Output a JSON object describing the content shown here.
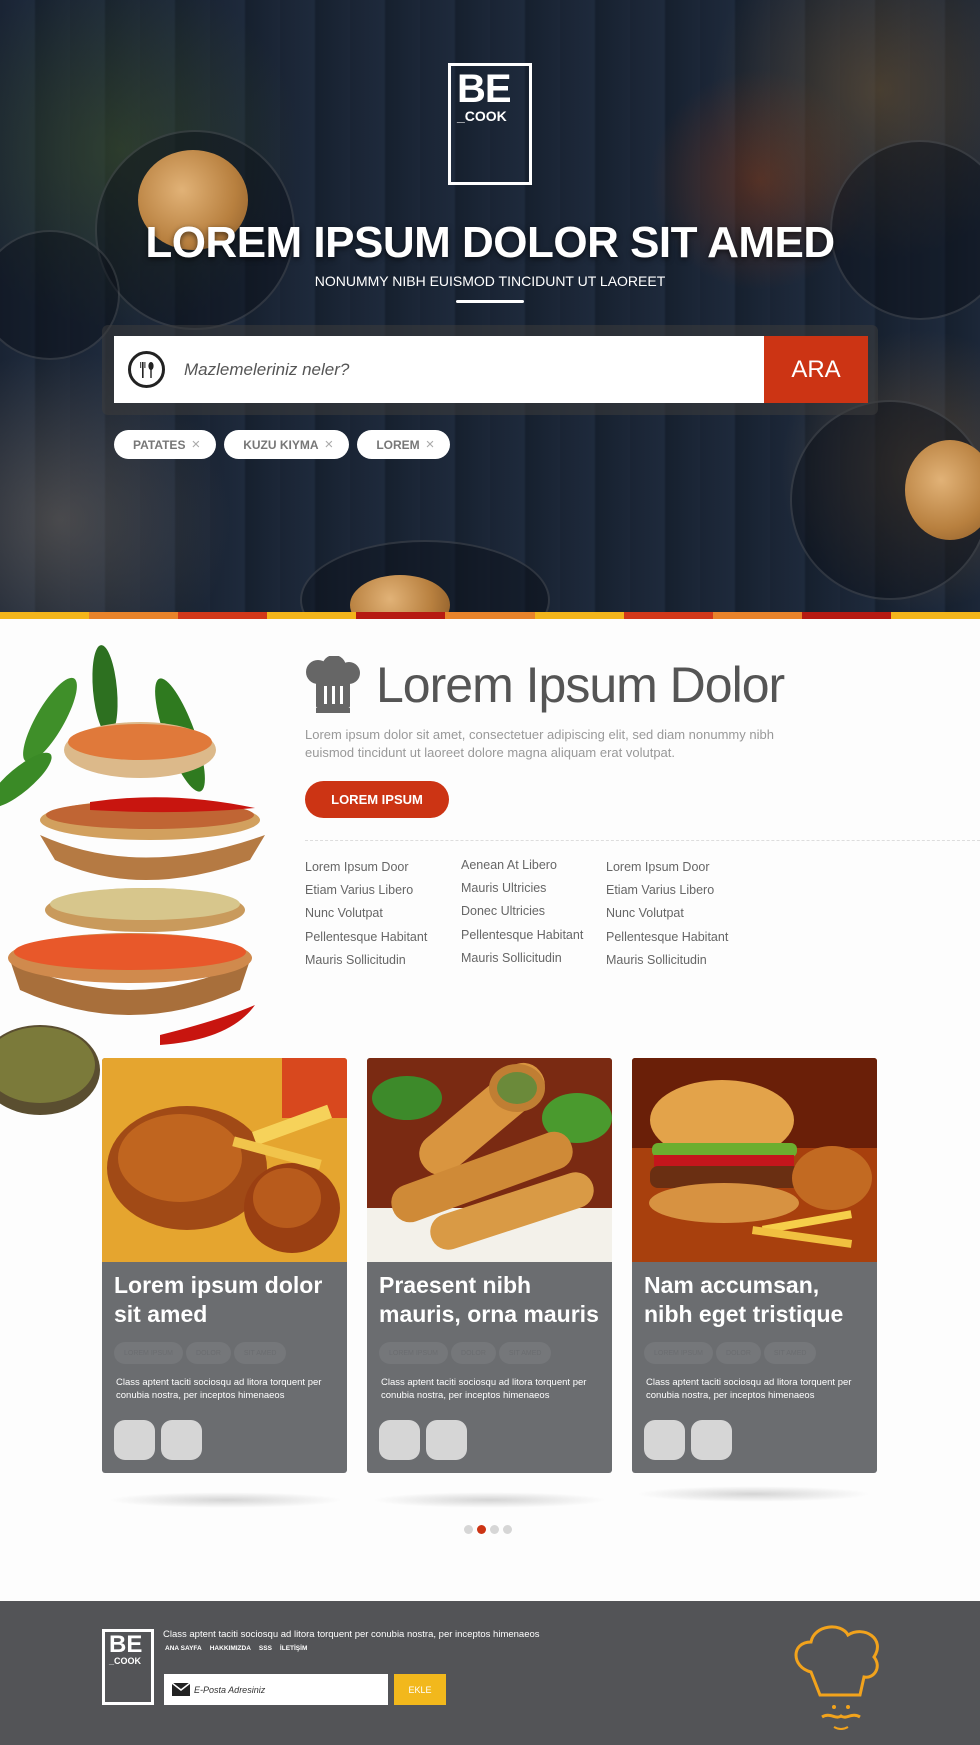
{
  "hero": {
    "logo_be": "BE",
    "logo_cook": "_COOK",
    "title": "LOREM IPSUM DOLOR SIT AMED",
    "subtitle": "NONUMMY NIBH EUISMOD TINCIDUNT UT LAOREET",
    "search_placeholder": "Mazlemeleriniz neler?",
    "search_button": "ARA",
    "tags": [
      "PATATES",
      "KUZU KIYMA",
      "LOREM"
    ],
    "tag_remove": "×"
  },
  "stripe_colors": [
    "#f3b51b",
    "#e8832a",
    "#d2381a",
    "#f3b51b",
    "#b61a12",
    "#e8832a",
    "#f3b51b",
    "#d2381a",
    "#e8832a",
    "#b61a12",
    "#f3b51b"
  ],
  "intro": {
    "title": "Lorem Ipsum Dolor",
    "text": "Lorem ipsum dolor sit amet, consectetuer adipiscing elit, sed diam nonummy nibh euismod tincidunt ut laoreet dolore magna aliquam erat volutpat.",
    "button": "LOREM IPSUM",
    "link_columns": [
      [
        "Lorem Ipsum Door",
        "Etiam Varius Libero",
        "Nunc Volutpat",
        "Pellentesque Habitant",
        "Mauris Sollicitudin"
      ],
      [
        "Aenean At Libero",
        "Mauris Ultricies",
        "Donec Ultricies",
        "Pellentesque Habitant",
        "Mauris Sollicitudin"
      ],
      [
        "Lorem Ipsum Door",
        "Etiam Varius Libero",
        "Nunc Volutpat",
        "Pellentesque Habitant",
        "Mauris Sollicitudin"
      ]
    ]
  },
  "cards": [
    {
      "title": "Lorem ipsum dolor sit amed",
      "tags": [
        "LOREM IPSUM",
        "DOLOR",
        "SIT AMED"
      ],
      "desc": "Class aptent taciti sociosqu ad litora torquent per conubia nostra, per inceptos himenaeos",
      "image": "roast-chicken"
    },
    {
      "title": "Praesent nibh mauris, orna mauris",
      "tags": [
        "LOREM IPSUM",
        "DOLOR",
        "SIT AMED"
      ],
      "desc": "Class aptent taciti sociosqu ad litora torquent per conubia nostra, per inceptos himenaeos",
      "image": "spring-rolls"
    },
    {
      "title": "Nam accumsan, nibh eget tristique",
      "tags": [
        "LOREM IPSUM",
        "DOLOR",
        "SIT AMED"
      ],
      "desc": "Class aptent taciti sociosqu ad litora torquent per conubia nostra, per inceptos himenaeos",
      "image": "burger"
    }
  ],
  "pagination": {
    "count": 4,
    "active": 2
  },
  "footer": {
    "logo_be": "BE",
    "logo_cook": "_COOK",
    "text": "Class aptent taciti sociosqu ad litora torquent per conubia nostra, per inceptos himenaeos",
    "nav": [
      "ANA SAYFA",
      "HAKKIMIZDA",
      "SSS",
      "İLETİŞİM"
    ],
    "email_placeholder": "E-Posta Adresiniz",
    "button": "EKLE"
  },
  "colors": {
    "accent": "#cc3414",
    "footer_bg": "#535457",
    "card_bg": "#6b6d70",
    "footer_button": "#f2b81c",
    "chef_icon": "#f2a31c"
  }
}
